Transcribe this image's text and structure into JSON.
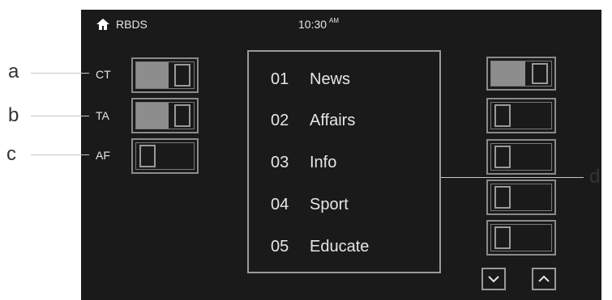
{
  "header": {
    "title": "RBDS",
    "time": "10:30",
    "ampm": "AM"
  },
  "callouts": {
    "a": "a",
    "b": "b",
    "c": "c",
    "d": "d"
  },
  "options": [
    {
      "label": "CT",
      "on": true
    },
    {
      "label": "TA",
      "on": true
    },
    {
      "label": "AF",
      "on": false
    }
  ],
  "pty_list": [
    {
      "num": "01",
      "name": "News"
    },
    {
      "num": "02",
      "name": "Affairs"
    },
    {
      "num": "03",
      "name": "Info"
    },
    {
      "num": "04",
      "name": "Sport"
    },
    {
      "num": "05",
      "name": "Educate"
    }
  ],
  "right_toggles": [
    true,
    false,
    false,
    false,
    false
  ],
  "icons": {
    "home": "home-icon",
    "down": "chevron-down-icon",
    "up": "chevron-up-icon"
  }
}
